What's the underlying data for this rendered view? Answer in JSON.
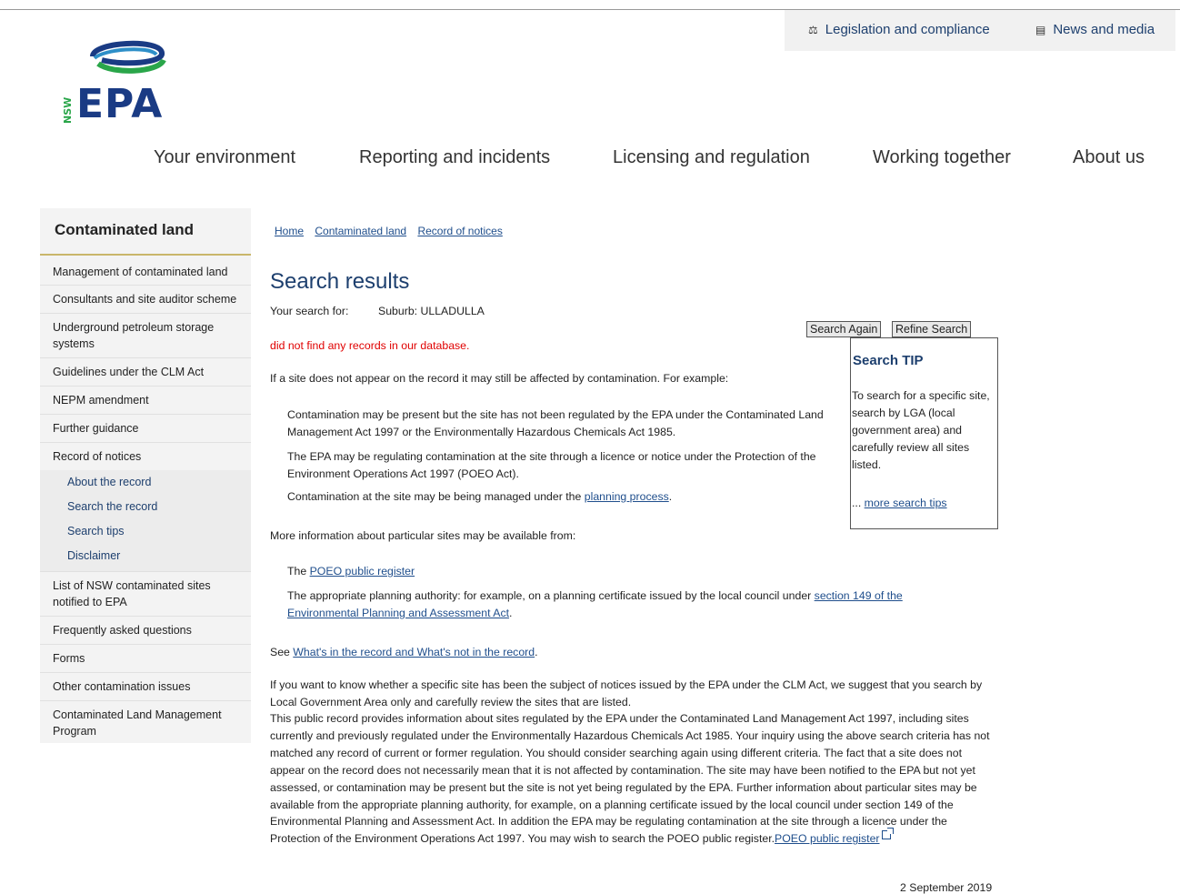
{
  "utility_nav": {
    "legislation_label": "Legislation and compliance",
    "news_label": "News and media"
  },
  "logo": {
    "text": "EPA",
    "state": "NSW"
  },
  "main_nav": [
    "Your environment",
    "Reporting and incidents",
    "Licensing and regulation",
    "Working together",
    "About us"
  ],
  "sidebar": {
    "title": "Contaminated land",
    "items": [
      "Management of contaminated land",
      "Consultants and site auditor scheme",
      "Underground petroleum storage systems",
      "Guidelines under the CLM Act",
      "NEPM amendment",
      "Further guidance",
      "Record of notices"
    ],
    "sub_items": [
      "About the record",
      "Search the record",
      "Search tips",
      "Disclaimer"
    ],
    "items_after": [
      "List of NSW contaminated sites notified to EPA",
      "Frequently asked questions",
      "Forms",
      "Other contamination issues",
      "Contaminated Land Management Program"
    ]
  },
  "breadcrumb": [
    "Home",
    "Contaminated land",
    "Record of notices"
  ],
  "page": {
    "title": "Search results",
    "search_for_label": "Your search for:",
    "search_for_value": "Suburb: ULLADULLA",
    "no_records": "did not find any records in our database.",
    "intro": "If a site does not appear on the record it may still be affected by contamination. For example:",
    "bullet1": "Contamination may be present but the site has not been regulated by the EPA under the Contaminated Land Management Act 1997 or the Environmentally Hazardous Chemicals Act 1985.",
    "bullet2": "The EPA may be regulating contamination at the site through a licence or notice under the Protection of the Environment Operations Act 1997 (POEO Act).",
    "bullet3_prefix": "Contamination at the site may be being managed under the ",
    "bullet3_link": "planning process",
    "bullet3_suffix": ".",
    "more_info": "More information about particular sites may be available from:",
    "poeo_prefix": "The ",
    "poeo_link": "POEO public register",
    "planning_prefix": "The appropriate planning authority: for example, on a planning certificate issued by the local council under ",
    "planning_link": "section 149 of the Environmental Planning and Assessment Act",
    "planning_suffix": ".",
    "see_prefix": "See ",
    "see_link": "What's in the record and What's not in the record",
    "see_suffix": ".",
    "para1": "If you want to know whether a specific site has been the subject of notices issued by the EPA under the CLM Act, we suggest that you search by Local Government Area only and carefully review the sites that are listed.",
    "para2": "This public record provides information about sites regulated by the EPA under the Contaminated Land Management Act 1997, including sites currently and previously regulated under the Environmentally Hazardous Chemicals Act 1985. Your inquiry using the above search criteria has not matched any record of current or former regulation. You should consider searching again using different criteria. The fact that a site does not appear on the record does not necessarily mean that it is not affected by contamination. The site may have been notified to the EPA but not yet assessed, or contamination may be present but the site is not yet being regulated by the EPA. Further information about particular sites may be available from the appropriate planning authority, for example, on a planning certificate issued by the local council under section 149 of the Environmental Planning and Assessment Act. In addition the EPA may be regulating contamination at the site through a licence under the Protection of the Environment Operations Act 1997. You may wish to search the POEO public register.",
    "para2_link": "POEO public register",
    "date": "2 September 2019"
  },
  "buttons": {
    "search_again": "Search Again",
    "refine_search": "Refine Search"
  },
  "tip": {
    "title": "Search TIP",
    "text": "To search for a specific site, search by LGA (local government area) and carefully review all sites listed.",
    "link_prefix": "... ",
    "link": "more search tips"
  }
}
